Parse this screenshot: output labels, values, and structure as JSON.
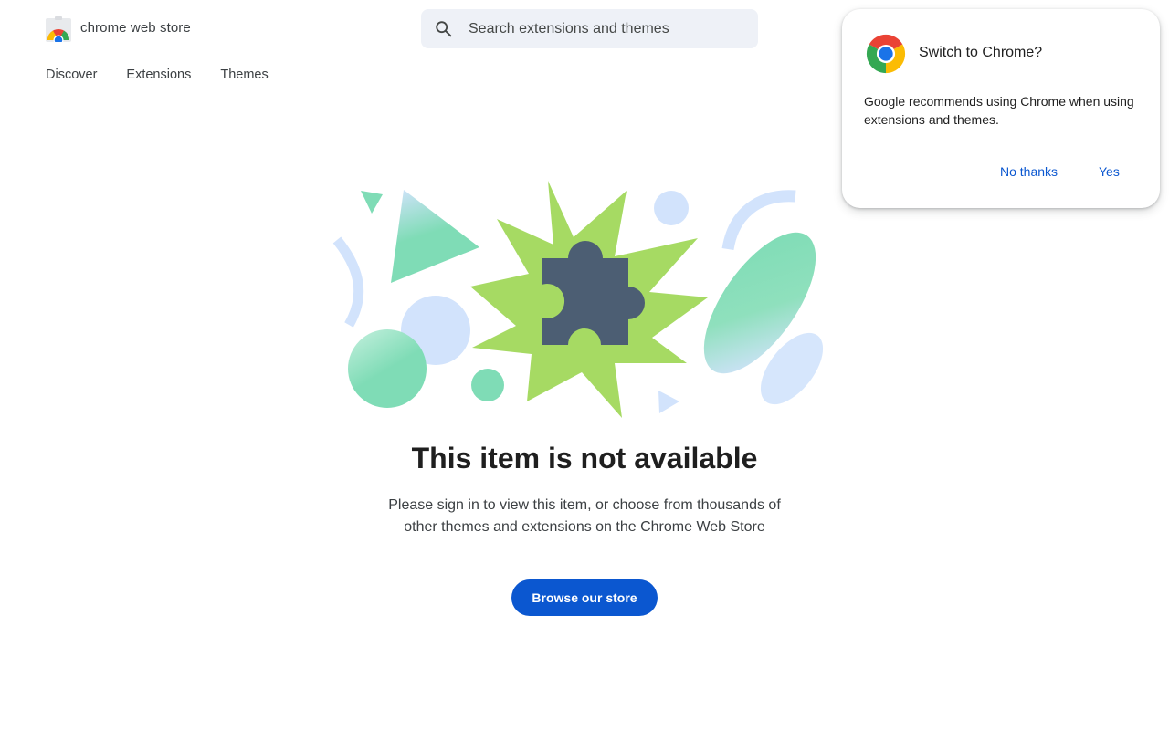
{
  "header": {
    "brand_name": "chrome web store",
    "search": {
      "placeholder": "Search extensions and themes"
    },
    "nav": [
      {
        "label": "Discover"
      },
      {
        "label": "Extensions"
      },
      {
        "label": "Themes"
      }
    ]
  },
  "main": {
    "title": "This item is not available",
    "description_line1": "Please sign in to view this item, or choose from thousands of",
    "description_line2": "other themes and extensions on the Chrome Web Store",
    "browse_button": "Browse our store"
  },
  "popup": {
    "title": "Switch to Chrome?",
    "body": "Google recommends using Chrome when using extensions and themes.",
    "no_button": "No thanks",
    "yes_button": "Yes"
  },
  "icons": {
    "logo": "chrome-web-store-logo-icon",
    "search": "search-icon",
    "illustration": "puzzle-piece-icon",
    "popup_logo": "chrome-logo-icon"
  },
  "colors": {
    "accent": "#0b57d0",
    "search_bg": "#eef1f7",
    "puzzle": "#4c5e73",
    "starburst": "#a6da63",
    "mint": "#7fdcb6",
    "light_blue": "#d2e3fc"
  }
}
